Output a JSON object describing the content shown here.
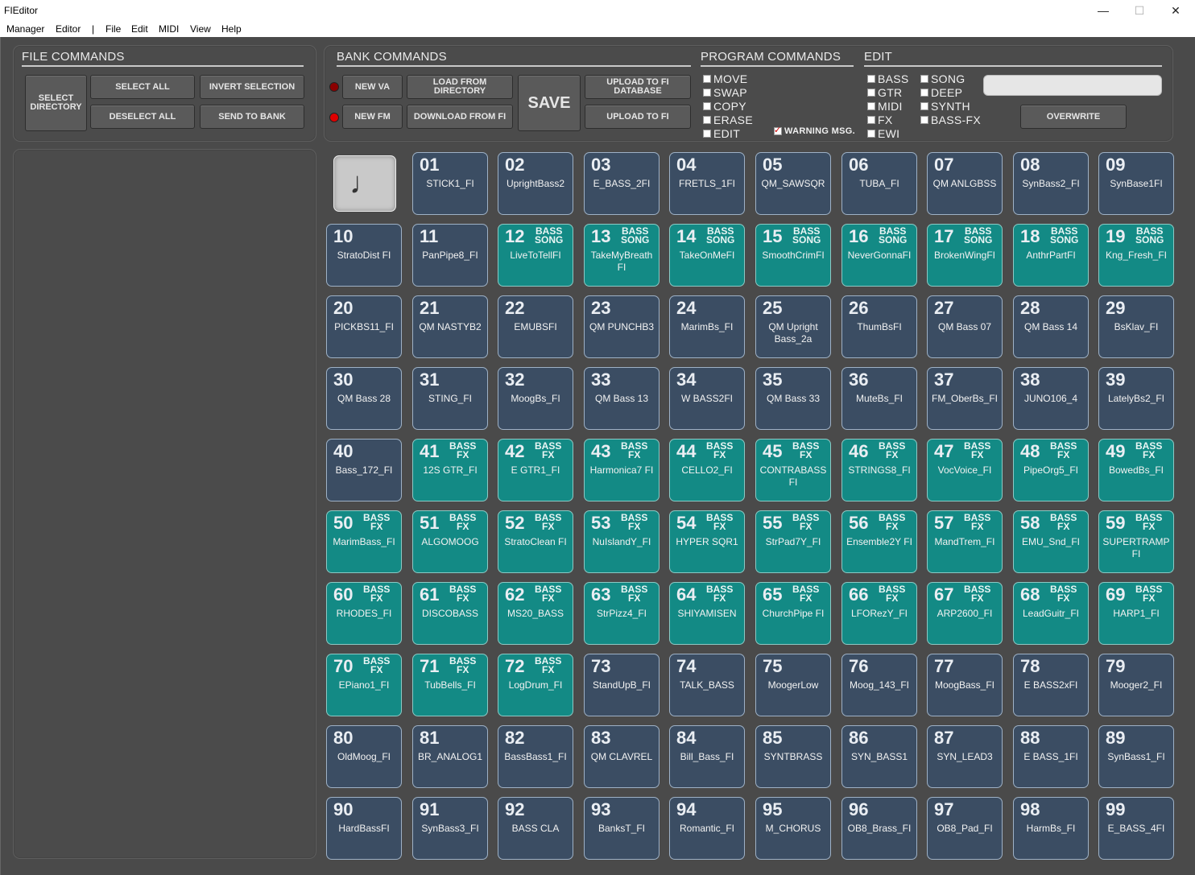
{
  "window": {
    "title": "FIEditor",
    "minimize": "—",
    "maximize": "☐",
    "close": "✕"
  },
  "menu": [
    "Manager",
    "Editor",
    "|",
    "File",
    "Edit",
    "MIDI",
    "View",
    "Help"
  ],
  "file_commands": {
    "title": "FILE COMMANDS",
    "select_directory": "SELECT DIRECTORY",
    "select_all": "SELECT ALL",
    "invert_selection": "INVERT SELECTION",
    "deselect_all": "DESELECT ALL",
    "send_to_bank": "SEND TO BANK"
  },
  "bank_commands": {
    "title": "BANK COMMANDS",
    "new_va": "NEW VA",
    "new_fm": "NEW FM",
    "load_from_directory": "LOAD FROM DIRECTORY",
    "download_from_fi": "DOWNLOAD FROM FI",
    "save": "SAVE",
    "upload_to_fi_database": "UPLOAD TO FI DATABASE",
    "upload_to_fi": "UPLOAD TO FI",
    "led_colors": [
      "#8b0000",
      "#e00000"
    ]
  },
  "program_commands": {
    "title": "PROGRAM COMMANDS",
    "options": [
      "MOVE",
      "SWAP",
      "COPY",
      "ERASE",
      "EDIT"
    ],
    "warning": "WARNING MSG.",
    "warning_checked": true
  },
  "edit": {
    "title": "EDIT",
    "col1": [
      "BASS",
      "GTR",
      "MIDI",
      "FX",
      "EWI"
    ],
    "col2": [
      "SONG",
      "DEEP",
      "SYNTH",
      "BASS-FX"
    ],
    "overwrite": "OVERWRITE"
  },
  "note_icon": "♩",
  "pads": [
    {
      "n": "01",
      "name": "STICK1_FI",
      "t": ""
    },
    {
      "n": "02",
      "name": "UprightBass2",
      "t": ""
    },
    {
      "n": "03",
      "name": "E_BASS_2FI",
      "t": ""
    },
    {
      "n": "04",
      "name": "FRETLS_1FI",
      "t": ""
    },
    {
      "n": "05",
      "name": "QM_SAWSQR",
      "t": ""
    },
    {
      "n": "06",
      "name": "TUBA_FI",
      "t": ""
    },
    {
      "n": "07",
      "name": "QM ANLGBSS",
      "t": ""
    },
    {
      "n": "08",
      "name": "SynBass2_FI",
      "t": ""
    },
    {
      "n": "09",
      "name": "SynBase1FI",
      "t": ""
    },
    {
      "n": "10",
      "name": "StratoDist FI",
      "t": ""
    },
    {
      "n": "11",
      "name": "PanPipe8_FI",
      "t": ""
    },
    {
      "n": "12",
      "name": "LiveToTellFI",
      "t": "song"
    },
    {
      "n": "13",
      "name": "TakeMyBreath FI",
      "t": "song"
    },
    {
      "n": "14",
      "name": "TakeOnMeFI",
      "t": "song"
    },
    {
      "n": "15",
      "name": "SmoothCrimFI",
      "t": "song"
    },
    {
      "n": "16",
      "name": "NeverGonnaFI",
      "t": "song"
    },
    {
      "n": "17",
      "name": "BrokenWingFI",
      "t": "song"
    },
    {
      "n": "18",
      "name": "AnthrPartFI",
      "t": "song"
    },
    {
      "n": "19",
      "name": "Kng_Fresh_FI",
      "t": "song"
    },
    {
      "n": "20",
      "name": "PICKBS11_FI",
      "t": ""
    },
    {
      "n": "21",
      "name": "QM NASTYB2",
      "t": ""
    },
    {
      "n": "22",
      "name": "EMUBSFI",
      "t": ""
    },
    {
      "n": "23",
      "name": "QM PUNCHB3",
      "t": ""
    },
    {
      "n": "24",
      "name": "MarimBs_FI",
      "t": ""
    },
    {
      "n": "25",
      "name": "QM Upright Bass_2a",
      "t": ""
    },
    {
      "n": "26",
      "name": "ThumBsFI",
      "t": ""
    },
    {
      "n": "27",
      "name": "QM Bass 07",
      "t": ""
    },
    {
      "n": "28",
      "name": "QM Bass 14",
      "t": ""
    },
    {
      "n": "29",
      "name": "BsKlav_FI",
      "t": ""
    },
    {
      "n": "30",
      "name": "QM Bass 28",
      "t": ""
    },
    {
      "n": "31",
      "name": "STING_FI",
      "t": ""
    },
    {
      "n": "32",
      "name": "MoogBs_FI",
      "t": ""
    },
    {
      "n": "33",
      "name": "QM Bass 13",
      "t": ""
    },
    {
      "n": "34",
      "name": "W BASS2FI",
      "t": ""
    },
    {
      "n": "35",
      "name": "QM Bass 33",
      "t": ""
    },
    {
      "n": "36",
      "name": "MuteBs_FI",
      "t": ""
    },
    {
      "n": "37",
      "name": "FM_OberBs_FI",
      "t": ""
    },
    {
      "n": "38",
      "name": "JUNO106_4",
      "t": ""
    },
    {
      "n": "39",
      "name": "LatelyBs2_FI",
      "t": ""
    },
    {
      "n": "40",
      "name": "Bass_172_FI",
      "t": ""
    },
    {
      "n": "41",
      "name": "12S GTR_FI",
      "t": "fx"
    },
    {
      "n": "42",
      "name": "E GTR1_FI",
      "t": "fx"
    },
    {
      "n": "43",
      "name": "Harmonica7 FI",
      "t": "fx"
    },
    {
      "n": "44",
      "name": "CELLO2_FI",
      "t": "fx"
    },
    {
      "n": "45",
      "name": "CONTRABASS FI",
      "t": "fx"
    },
    {
      "n": "46",
      "name": "STRINGS8_FI",
      "t": "fx"
    },
    {
      "n": "47",
      "name": "VocVoice_FI",
      "t": "fx"
    },
    {
      "n": "48",
      "name": "PipeOrg5_FI",
      "t": "fx"
    },
    {
      "n": "49",
      "name": "BowedBs_FI",
      "t": "fx"
    },
    {
      "n": "50",
      "name": "MarimBass_FI",
      "t": "fx"
    },
    {
      "n": "51",
      "name": "ALGOMOOG",
      "t": "fx"
    },
    {
      "n": "52",
      "name": "StratoClean FI",
      "t": "fx"
    },
    {
      "n": "53",
      "name": "NuIslandY_FI",
      "t": "fx"
    },
    {
      "n": "54",
      "name": "HYPER SQR1",
      "t": "fx"
    },
    {
      "n": "55",
      "name": "StrPad7Y_FI",
      "t": "fx"
    },
    {
      "n": "56",
      "name": "Ensemble2Y FI",
      "t": "fx"
    },
    {
      "n": "57",
      "name": "MandTrem_FI",
      "t": "fx"
    },
    {
      "n": "58",
      "name": "EMU_Snd_FI",
      "t": "fx"
    },
    {
      "n": "59",
      "name": "SUPERTRAMP FI",
      "t": "fx"
    },
    {
      "n": "60",
      "name": "RHODES_FI",
      "t": "fx"
    },
    {
      "n": "61",
      "name": "DISCOBASS",
      "t": "fx"
    },
    {
      "n": "62",
      "name": "MS20_BASS",
      "t": "fx"
    },
    {
      "n": "63",
      "name": "StrPizz4_FI",
      "t": "fx"
    },
    {
      "n": "64",
      "name": "SHIYAMISEN",
      "t": "fx"
    },
    {
      "n": "65",
      "name": "ChurchPipe FI",
      "t": "fx"
    },
    {
      "n": "66",
      "name": "LFORezY_FI",
      "t": "fx"
    },
    {
      "n": "67",
      "name": "ARP2600_FI",
      "t": "fx"
    },
    {
      "n": "68",
      "name": "LeadGuitr_FI",
      "t": "fx"
    },
    {
      "n": "69",
      "name": "HARP1_FI",
      "t": "fx"
    },
    {
      "n": "70",
      "name": "EPiano1_FI",
      "t": "fx"
    },
    {
      "n": "71",
      "name": "TubBells_FI",
      "t": "fx"
    },
    {
      "n": "72",
      "name": "LogDrum_FI",
      "t": "fx"
    },
    {
      "n": "73",
      "name": "StandUpB_FI",
      "t": ""
    },
    {
      "n": "74",
      "name": "TALK_BASS",
      "t": ""
    },
    {
      "n": "75",
      "name": "MoogerLow",
      "t": ""
    },
    {
      "n": "76",
      "name": "Moog_143_FI",
      "t": ""
    },
    {
      "n": "77",
      "name": "MoogBass_FI",
      "t": ""
    },
    {
      "n": "78",
      "name": "E BASS2xFI",
      "t": ""
    },
    {
      "n": "79",
      "name": "Mooger2_FI",
      "t": ""
    },
    {
      "n": "80",
      "name": "OldMoog_FI",
      "t": ""
    },
    {
      "n": "81",
      "name": "BR_ANALOG1",
      "t": ""
    },
    {
      "n": "82",
      "name": "BassBass1_FI",
      "t": ""
    },
    {
      "n": "83",
      "name": "QM CLAVREL",
      "t": ""
    },
    {
      "n": "84",
      "name": "Bill_Bass_FI",
      "t": ""
    },
    {
      "n": "85",
      "name": "SYNTBRASS",
      "t": ""
    },
    {
      "n": "86",
      "name": "SYN_BASS1",
      "t": ""
    },
    {
      "n": "87",
      "name": "SYN_LEAD3",
      "t": ""
    },
    {
      "n": "88",
      "name": "E BASS_1FI",
      "t": ""
    },
    {
      "n": "89",
      "name": "SynBass1_FI",
      "t": ""
    },
    {
      "n": "90",
      "name": "HardBassFI",
      "t": ""
    },
    {
      "n": "91",
      "name": "SynBass3_FI",
      "t": ""
    },
    {
      "n": "92",
      "name": "BASS CLA",
      "t": ""
    },
    {
      "n": "93",
      "name": "BanksT_FI",
      "t": ""
    },
    {
      "n": "94",
      "name": "Romantic_FI",
      "t": ""
    },
    {
      "n": "95",
      "name": "M_CHORUS",
      "t": ""
    },
    {
      "n": "96",
      "name": "OB8_Brass_FI",
      "t": ""
    },
    {
      "n": "97",
      "name": "OB8_Pad_FI",
      "t": ""
    },
    {
      "n": "98",
      "name": "HarmBs_FI",
      "t": ""
    },
    {
      "n": "99",
      "name": "E_BASS_4FI",
      "t": ""
    }
  ],
  "tag_labels": {
    "song": [
      "BASS",
      "SONG"
    ],
    "fx": [
      "BASS",
      "FX"
    ]
  }
}
